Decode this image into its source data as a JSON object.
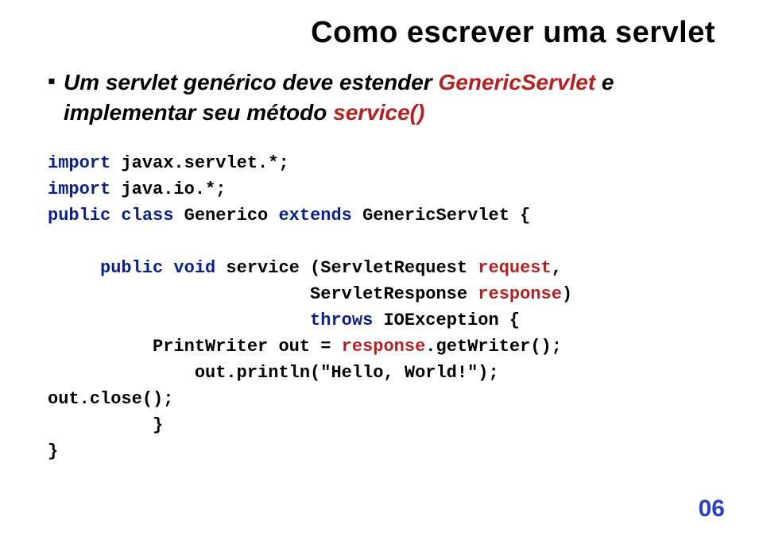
{
  "title": "Como escrever uma servlet",
  "bullet": {
    "part1": "Um servlet genérico deve estender ",
    "kw1": "GenericServlet",
    "part2": " e implementar seu método ",
    "kw2": "service()"
  },
  "code": {
    "l1a": "import",
    "l1b": " javax.servlet.*;",
    "l2a": "import",
    "l2b": " java.io.*;",
    "l3a": "public class",
    "l3b": " Generico ",
    "l3c": "extends",
    "l3d": " GenericServlet {",
    "blank1": "",
    "l5a": "     public void",
    "l5b": " service (ServletRequest ",
    "l5c": "request",
    "l5d": ",",
    "l6a": "                         ServletResponse ",
    "l6b": "response",
    "l6c": ")",
    "l7a": "                         throws",
    "l7b": " IOException {",
    "l8a": "          PrintWriter out = ",
    "l8b": "response",
    "l8c": ".getWriter();",
    "l9": "              out.println(\"Hello, World!\");",
    "l10": "out.close();",
    "l11": "          }",
    "l12": "}"
  },
  "pageNumber": "06"
}
